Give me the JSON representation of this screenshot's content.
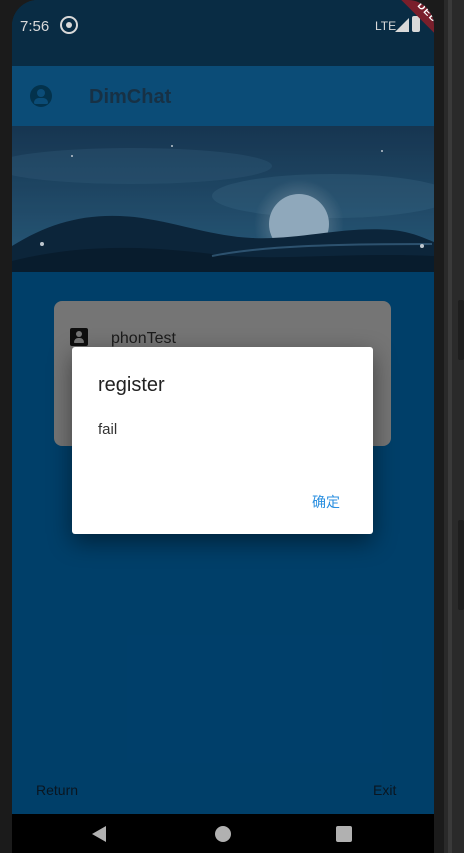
{
  "status_bar": {
    "time": "7:56",
    "network": "LTE"
  },
  "debug_banner": {
    "label": "DEBUG"
  },
  "app_bar": {
    "title": "DimChat"
  },
  "contact_card": {
    "name": "phonTest"
  },
  "dialog": {
    "title": "register",
    "message": "fail",
    "confirm_label": "确定"
  },
  "bottom_actions": {
    "return_label": "Return",
    "exit_label": "Exit"
  },
  "colors": {
    "app_bar": "#0d5a8c",
    "content_bg": "#004a7c",
    "dialog_button": "#2a8fe0",
    "debug_ribbon": "#7a1f2b"
  },
  "icons": {
    "app_bar": "account-circle-icon",
    "card": "contact-icon",
    "status": [
      "sync-icon",
      "signal-icon",
      "battery-icon"
    ],
    "nav": [
      "back-icon",
      "home-icon",
      "recents-icon"
    ]
  }
}
